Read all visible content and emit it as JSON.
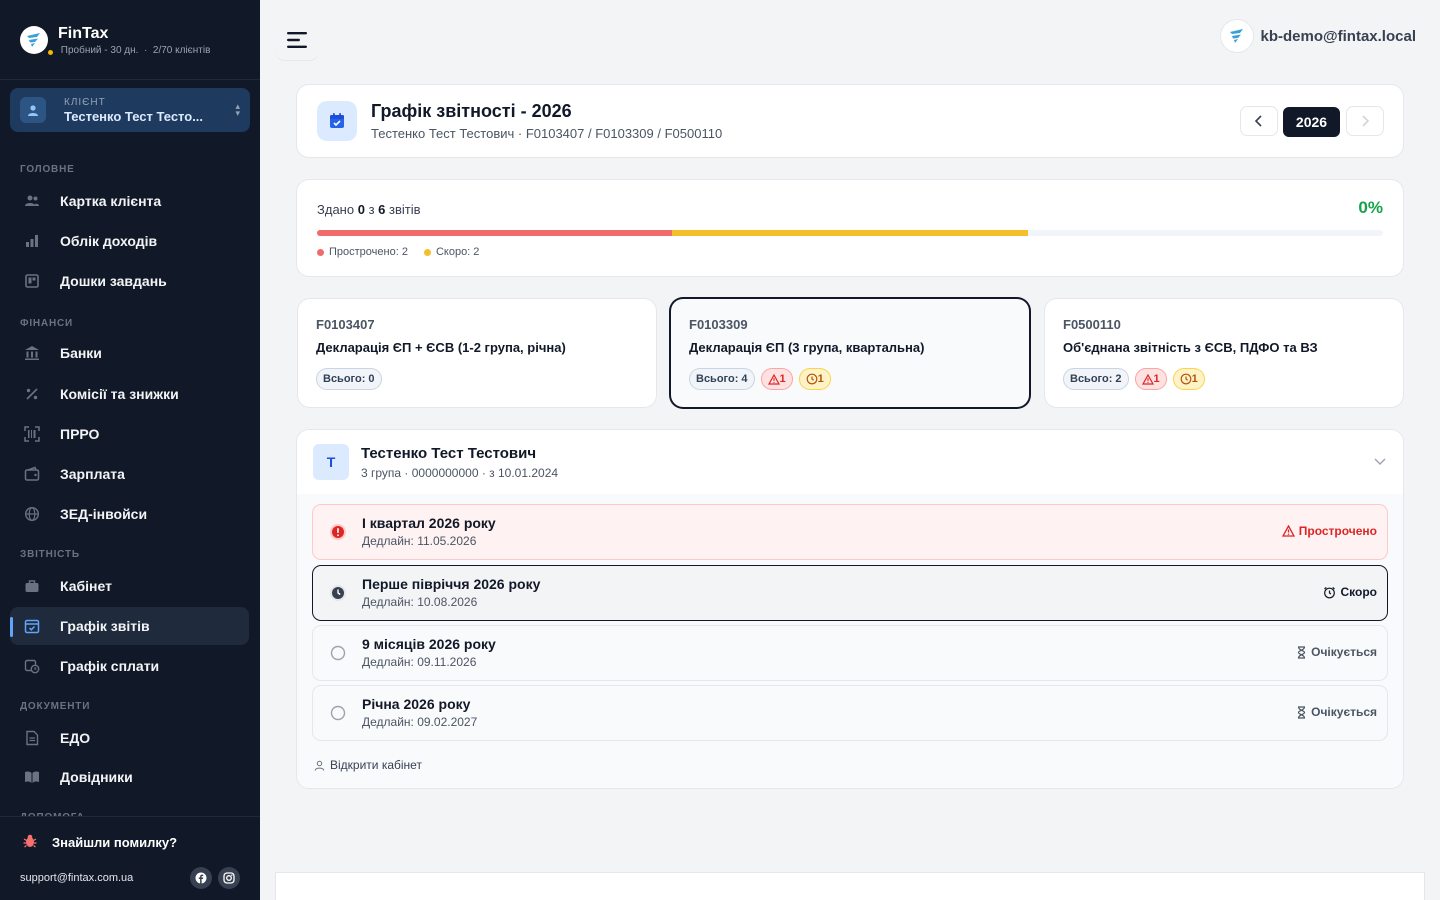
{
  "brand": {
    "name": "FinTax",
    "plan": "Пробний - 30 дн.",
    "clients": "2/70 клієнтів"
  },
  "client_selector": {
    "label": "КЛІЄНТ",
    "name": "Тестенко Тест Тесто..."
  },
  "sidebar": {
    "sections": [
      "Головне",
      "Фінанси",
      "Звітність",
      "Документи",
      "Допомога"
    ],
    "items": [
      {
        "label": "Картка клієнта",
        "icon": "users-icon"
      },
      {
        "label": "Облік доходів",
        "icon": "bar-chart-icon"
      },
      {
        "label": "Дошки завдань",
        "icon": "board-icon"
      },
      {
        "label": "Банки",
        "icon": "bank-icon"
      },
      {
        "label": "Комісії та знижки",
        "icon": "percent-icon"
      },
      {
        "label": "ПРРО",
        "icon": "scanner-icon"
      },
      {
        "label": "Зарплата",
        "icon": "wallet-icon"
      },
      {
        "label": "ЗЕД-інвойси",
        "icon": "globe-icon"
      },
      {
        "label": "Кабінет",
        "icon": "briefcase-icon"
      },
      {
        "label": "Графік звітів",
        "icon": "calendar-icon",
        "active": true
      },
      {
        "label": "Графік сплати",
        "icon": "calendar-clock-icon"
      },
      {
        "label": "ЕДО",
        "icon": "document-icon"
      },
      {
        "label": "Довідники",
        "icon": "book-icon"
      }
    ],
    "bug_report": "Знайшли помилку?",
    "support_email": "support@fintax.com.ua"
  },
  "topbar": {
    "user": "kb-demo@fintax.local"
  },
  "header": {
    "title": "Графік звітності - 2026",
    "subtitle": "Тестенко Тест Тестович · F0103407 / F0103309 / F0500110",
    "year": "2026"
  },
  "progress": {
    "prefix": "Здано",
    "done": "0",
    "of": "з",
    "total": "6",
    "suffix": "звітів",
    "percent": "0%",
    "overdue_share": 0.3333,
    "soon_share": 0.3333,
    "legend_overdue": "Прострочено: 2",
    "legend_soon": "Скоро: 2",
    "colors": {
      "overdue": "#f06b6b",
      "soon": "#f4bf2a",
      "done": "#16a34a"
    }
  },
  "forms": [
    {
      "code": "F0103407",
      "name": "Декларація ЄП + ЄСВ (1-2 група, річна)",
      "total": "Всього: 0",
      "overdue": "",
      "soon": ""
    },
    {
      "code": "F0103309",
      "name": "Декларація ЄП (3 група, квартальна)",
      "total": "Всього: 4",
      "overdue": "1",
      "soon": "1",
      "selected": true
    },
    {
      "code": "F0500110",
      "name": "Об'єднана звітність з ЄСВ, ПДФО та ВЗ",
      "total": "Всього: 2",
      "overdue": "1",
      "soon": "1"
    }
  ],
  "client_group": {
    "initial": "Т",
    "name": "Тестенко Тест Тестович",
    "details": "3 група · 0000000000 · з 10.01.2024",
    "open_cabinet": "Відкрити кабінет",
    "reports": [
      {
        "title": "І квартал 2026 року",
        "deadline": "Дедлайн: 11.05.2026",
        "status": "Прострочено",
        "state": "overdue"
      },
      {
        "title": "Перше півріччя 2026 року",
        "deadline": "Дедлайн: 10.08.2026",
        "status": "Скоро",
        "state": "soon"
      },
      {
        "title": "9 місяців 2026 року",
        "deadline": "Дедлайн: 09.11.2026",
        "status": "Очікується",
        "state": "pending"
      },
      {
        "title": "Річна 2026 року",
        "deadline": "Дедлайн: 09.02.2027",
        "status": "Очікується",
        "state": "pending"
      }
    ]
  }
}
